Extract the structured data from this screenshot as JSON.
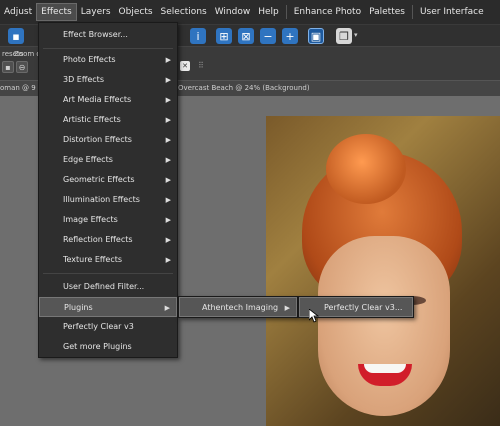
{
  "menubar": {
    "items": [
      "Adjust",
      "Effects",
      "Layers",
      "Objects",
      "Selections",
      "Window",
      "Help",
      "Enhance Photo",
      "Palettes",
      "User Interface"
    ],
    "active": "Effects"
  },
  "options": {
    "zoom_label": "Zoom o",
    "presets_label": "resets"
  },
  "tabs": {
    "left": "oman @  9",
    "right": "Overcast Beach @  24% (Background)"
  },
  "effects_menu": {
    "items": [
      {
        "label": "Effect Browser...",
        "submenu": false
      },
      {
        "label": "Photo Effects",
        "submenu": true
      },
      {
        "label": "3D Effects",
        "submenu": true
      },
      {
        "label": "Art Media Effects",
        "submenu": true
      },
      {
        "label": "Artistic Effects",
        "submenu": true
      },
      {
        "label": "Distortion Effects",
        "submenu": true
      },
      {
        "label": "Edge Effects",
        "submenu": true
      },
      {
        "label": "Geometric Effects",
        "submenu": true
      },
      {
        "label": "Illumination Effects",
        "submenu": true
      },
      {
        "label": "Image Effects",
        "submenu": true
      },
      {
        "label": "Reflection Effects",
        "submenu": true
      },
      {
        "label": "Texture Effects",
        "submenu": true
      },
      {
        "label": "User Defined Filter...",
        "submenu": false
      },
      {
        "label": "Plugins",
        "submenu": true
      },
      {
        "label": "Perfectly Clear v3",
        "submenu": false
      },
      {
        "label": "Get more Plugins",
        "submenu": false
      }
    ]
  },
  "plugins_menu": {
    "item": "Athentech Imaging"
  },
  "athentech_menu": {
    "item": "Perfectly Clear v3..."
  },
  "colors": {
    "menu_bg": "#2e2e2e",
    "highlight": "#565656",
    "accent_blue": "#2f74c0"
  }
}
